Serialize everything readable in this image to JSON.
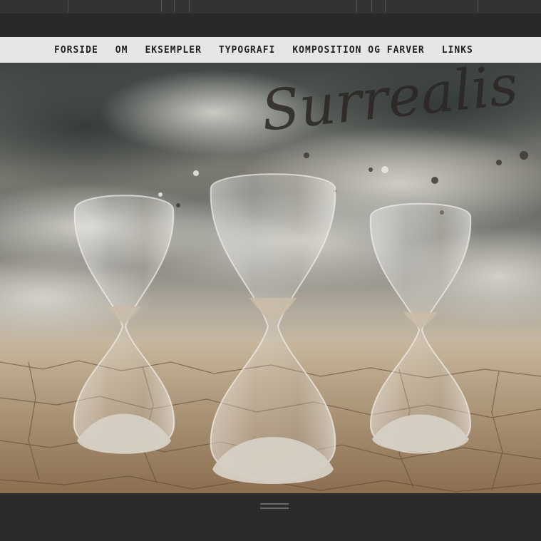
{
  "nav": {
    "items": [
      "Forside",
      "Om",
      "Eksempler",
      "Typografi",
      "Komposition og farver",
      "Links"
    ]
  },
  "hero": {
    "script_text": "Surrealis"
  },
  "icons": {
    "menu_handle": "menu-handle-icon"
  },
  "colors": {
    "nav_bg": "#e6e6e6",
    "page_bg": "#2a2a2a"
  }
}
